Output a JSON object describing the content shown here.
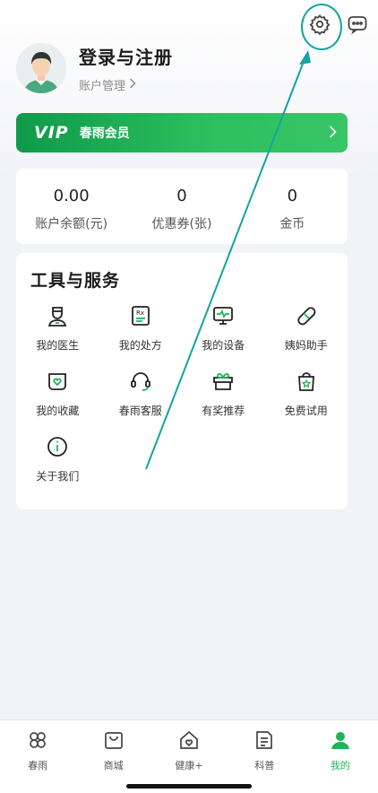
{
  "header": {
    "settings_icon": "gear-icon",
    "message_icon": "chat-bubble-icon"
  },
  "profile": {
    "title": "登录与注册",
    "account_link": "账户管理"
  },
  "vip": {
    "logo": "VIP",
    "label": "春雨会员"
  },
  "stats": [
    {
      "value": "0.00",
      "label": "账户余额(元)"
    },
    {
      "value": "0",
      "label": "优惠券(张)"
    },
    {
      "value": "0",
      "label": "金币"
    }
  ],
  "tools": {
    "title": "工具与服务",
    "items": [
      {
        "label": "我的医生",
        "icon": "doctor-icon"
      },
      {
        "label": "我的处方",
        "icon": "prescription-icon"
      },
      {
        "label": "我的设备",
        "icon": "device-monitor-icon"
      },
      {
        "label": "姨妈助手",
        "icon": "bandage-icon"
      },
      {
        "label": "我的收藏",
        "icon": "heart-box-icon"
      },
      {
        "label": "春雨客服",
        "icon": "headset-icon"
      },
      {
        "label": "有奖推荐",
        "icon": "gift-icon"
      },
      {
        "label": "免费试用",
        "icon": "shopping-bag-star-icon"
      },
      {
        "label": "关于我们",
        "icon": "info-icon"
      }
    ]
  },
  "bottom_nav": [
    {
      "label": "春雨",
      "icon": "clover-icon",
      "active": false
    },
    {
      "label": "商城",
      "icon": "bag-icon",
      "active": false
    },
    {
      "label": "健康+",
      "icon": "heart-home-icon",
      "active": false
    },
    {
      "label": "科普",
      "icon": "article-icon",
      "active": false
    },
    {
      "label": "我的",
      "icon": "person-icon",
      "active": true
    }
  ],
  "colors": {
    "accent_green": "#1fb35a",
    "annotation_teal": "#13a3a3"
  }
}
